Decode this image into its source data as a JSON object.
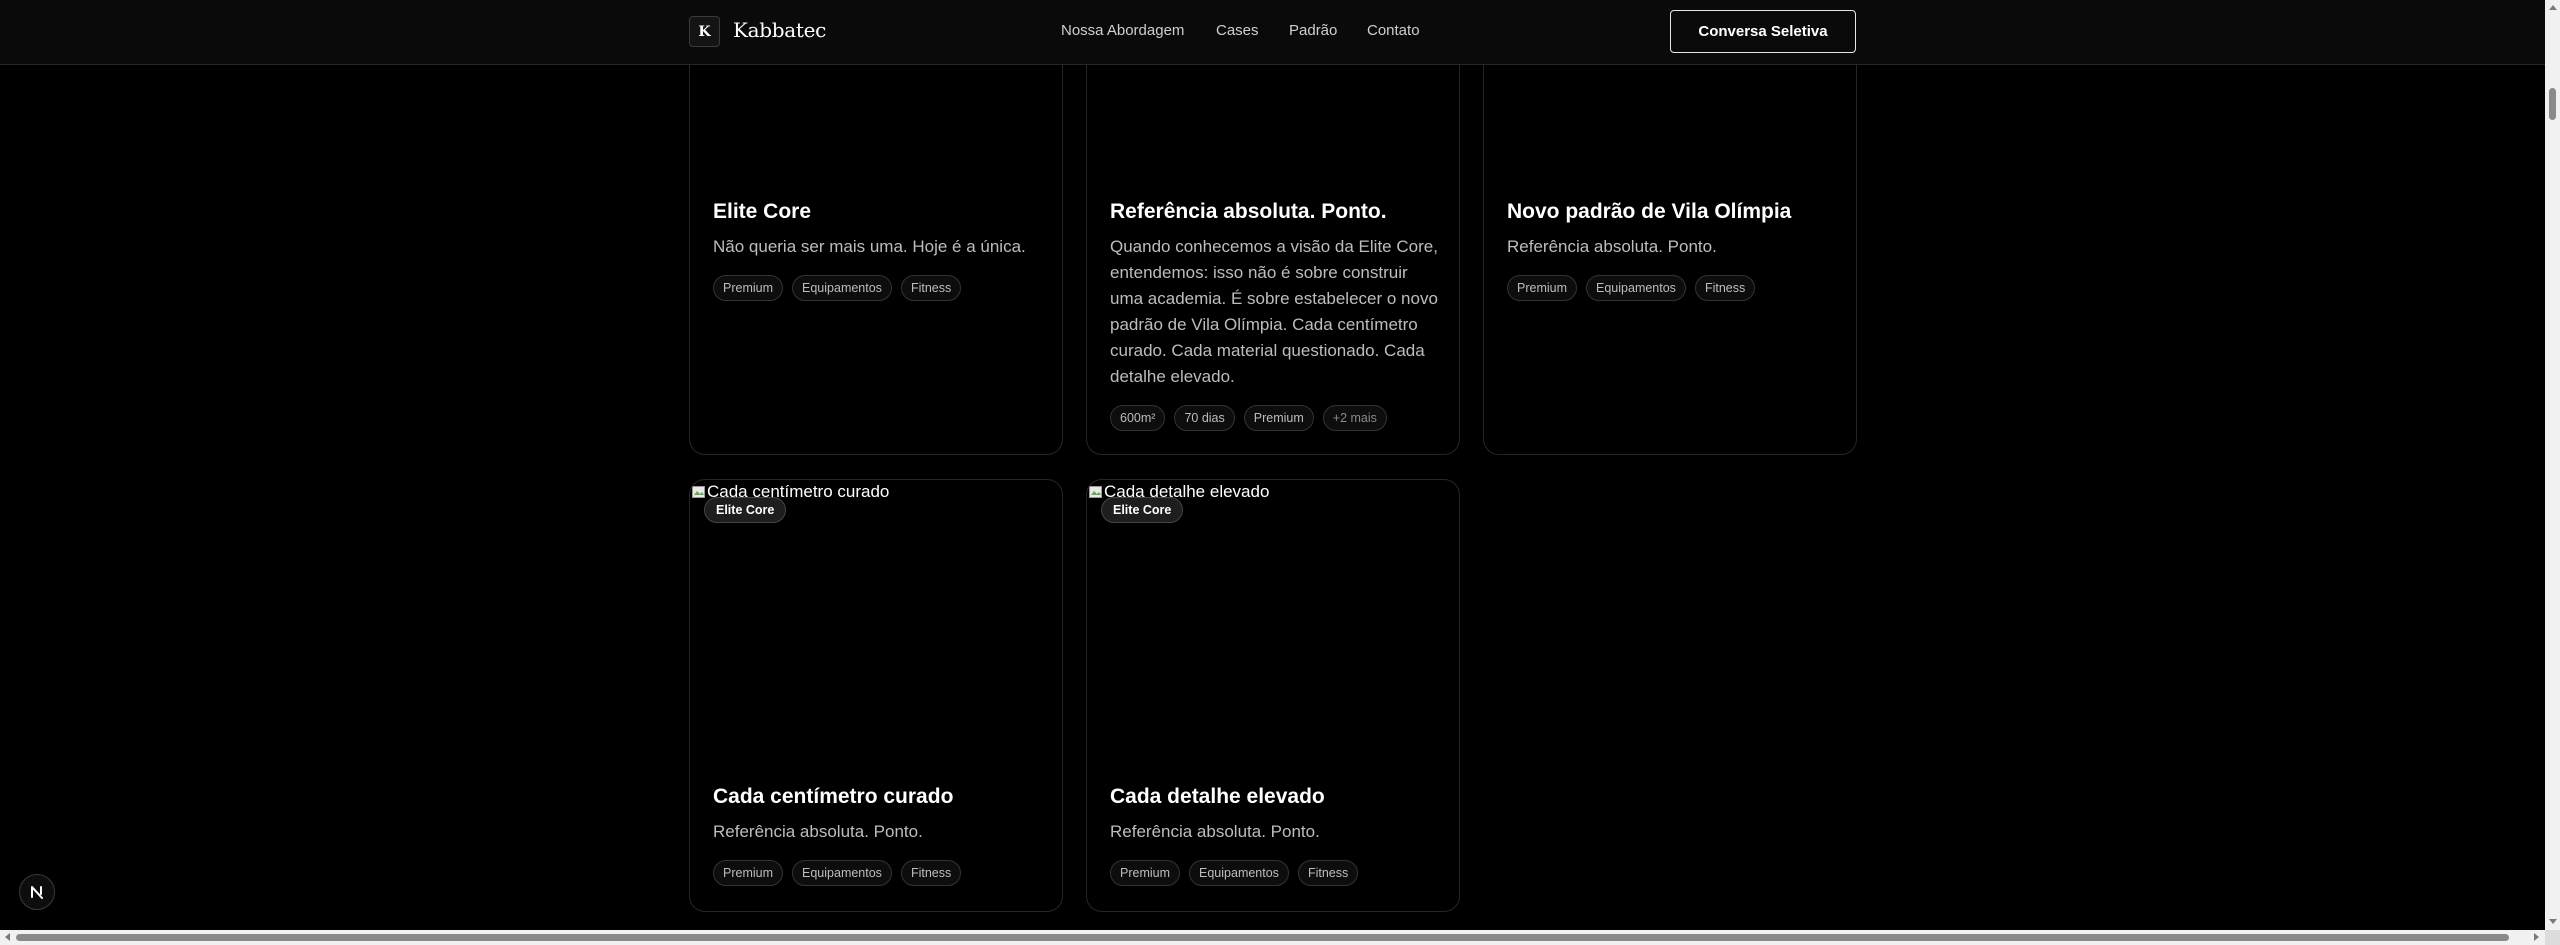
{
  "header": {
    "logo_letter": "K",
    "brand": "Kabbatec",
    "nav": [
      {
        "label": "Nossa Abordagem"
      },
      {
        "label": "Cases"
      },
      {
        "label": "Padrão"
      },
      {
        "label": "Contato"
      }
    ],
    "cta_label": "Conversa Seletiva"
  },
  "cards": [
    {
      "title": "Elite Core",
      "description": "Não queria ser mais uma. Hoje é a única.",
      "tags": [
        "Premium",
        "Equipamentos",
        "Fitness"
      ]
    },
    {
      "title": "Referência absoluta. Ponto.",
      "description": "Quando conhecemos a visão da Elite Core, entendemos: isso não é sobre construir uma academia. É sobre estabelecer o novo padrão de Vila Olímpia. Cada centímetro curado. Cada material questionado. Cada detalhe elevado.",
      "tags": [
        "600m²",
        "70 dias",
        "Premium"
      ],
      "more_tag": "+2 mais"
    },
    {
      "title": "Novo padrão de Vila Olímpia",
      "description": "Referência absoluta. Ponto.",
      "tags": [
        "Premium",
        "Equipamentos",
        "Fitness"
      ]
    },
    {
      "image_alt": "Cada centímetro curado",
      "badge": "Elite Core",
      "title": "Cada centímetro curado",
      "description": "Referência absoluta. Ponto.",
      "tags": [
        "Premium",
        "Equipamentos",
        "Fitness"
      ]
    },
    {
      "image_alt": "Cada detalhe elevado",
      "badge": "Elite Core",
      "title": "Cada detalhe elevado",
      "description": "Referência absoluta. Ponto.",
      "tags": [
        "Premium",
        "Equipamentos",
        "Fitness"
      ]
    }
  ],
  "dev_indicator": {
    "letter": "N"
  }
}
